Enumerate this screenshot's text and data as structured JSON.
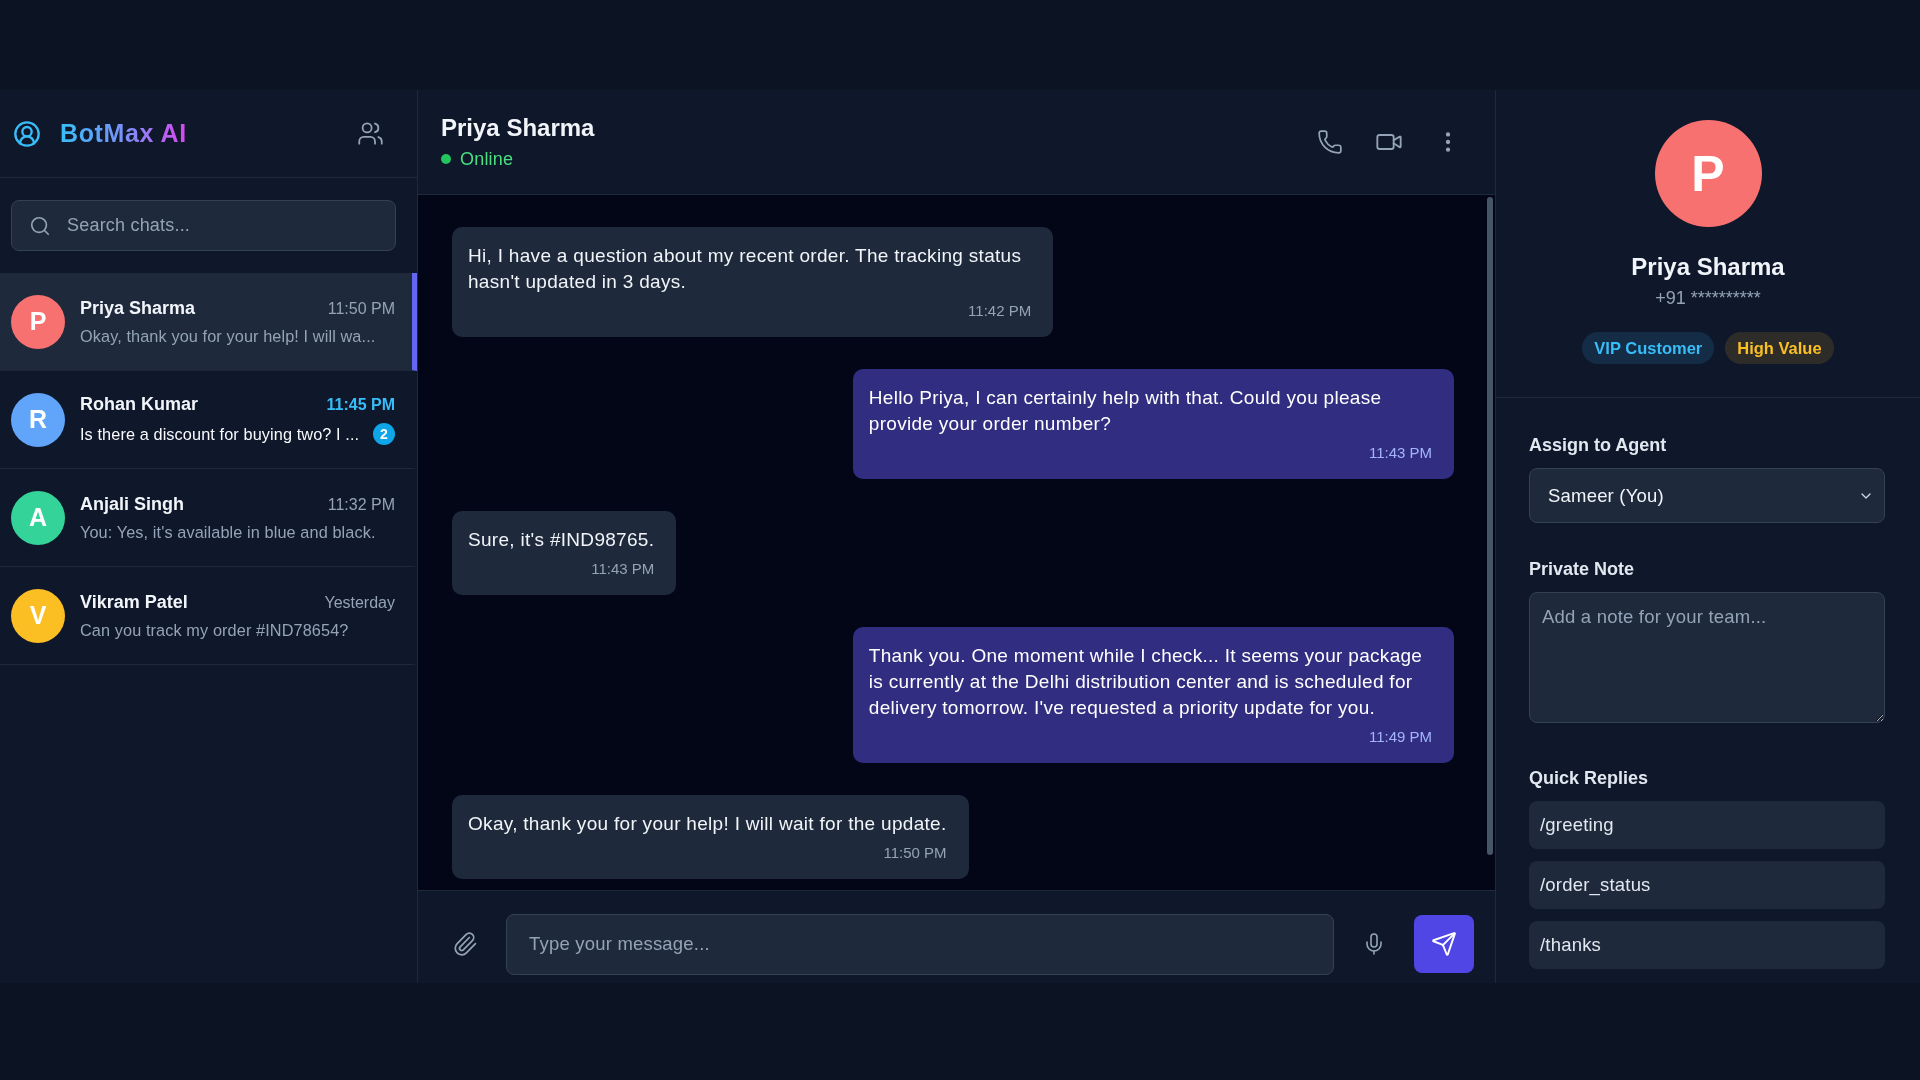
{
  "sidebar": {
    "brand": "BotMax AI",
    "search": {
      "placeholder": "Search chats..."
    },
    "chats": [
      {
        "initial": "P",
        "name": "Priya Sharma",
        "time": "11:50 PM",
        "preview": "Okay, thank you for your help! I will wa...",
        "color": "#f87171",
        "selected": true,
        "unread": false
      },
      {
        "initial": "R",
        "name": "Rohan Kumar",
        "time": "11:45 PM",
        "preview": "Is there a discount for buying two? I ...",
        "badge": "2",
        "color": "#60a5fa",
        "selected": false,
        "unread": true
      },
      {
        "initial": "A",
        "name": "Anjali Singh",
        "time": "11:32 PM",
        "preview": "You: Yes, it's available in blue and black.",
        "color": "#34d399",
        "selected": false,
        "unread": false
      },
      {
        "initial": "V",
        "name": "Vikram Patel",
        "time": "Yesterday",
        "preview": "Can you track my order #IND78654?",
        "color": "#fbbf24",
        "selected": false,
        "unread": false
      }
    ]
  },
  "chat": {
    "contact": {
      "name": "Priya Sharma",
      "status": "Online",
      "online": true
    },
    "messages": [
      {
        "kind": "incoming",
        "text": "Hi, I have a question about my recent order. The tracking status hasn't updated in 3 days.",
        "time": "11:42 PM"
      },
      {
        "kind": "outgoing",
        "text": "Hello Priya, I can certainly help with that. Could you please provide your order number?",
        "time": "11:43 PM"
      },
      {
        "kind": "incoming",
        "text": "Sure, it's #IND98765.",
        "time": "11:43 PM"
      },
      {
        "kind": "outgoing",
        "text": "Thank you. One moment while I check... It seems your package is currently at the Delhi distribution center and is scheduled for delivery tomorrow. I've requested a priority update for you.",
        "time": "11:49 PM"
      },
      {
        "kind": "incoming",
        "text": "Okay, thank you for your help! I will wait for the update.",
        "time": "11:50 PM"
      }
    ],
    "composer": {
      "placeholder": "Type your message..."
    }
  },
  "profile": {
    "initial": "P",
    "color": "#f87171",
    "name": "Priya Sharma",
    "phone": "+91 **********",
    "tags": [
      {
        "label": "VIP Customer",
        "color": "#38bdf8"
      },
      {
        "label": "High Value",
        "color": "#fbbf24"
      }
    ],
    "assign": {
      "label": "Assign to Agent",
      "value": "Sameer (You)"
    },
    "note": {
      "label": "Private Note",
      "placeholder": "Add a note for your team..."
    },
    "quick_replies": {
      "label": "Quick Replies",
      "items": [
        "/greeting",
        "/order_status",
        "/thanks"
      ]
    }
  }
}
